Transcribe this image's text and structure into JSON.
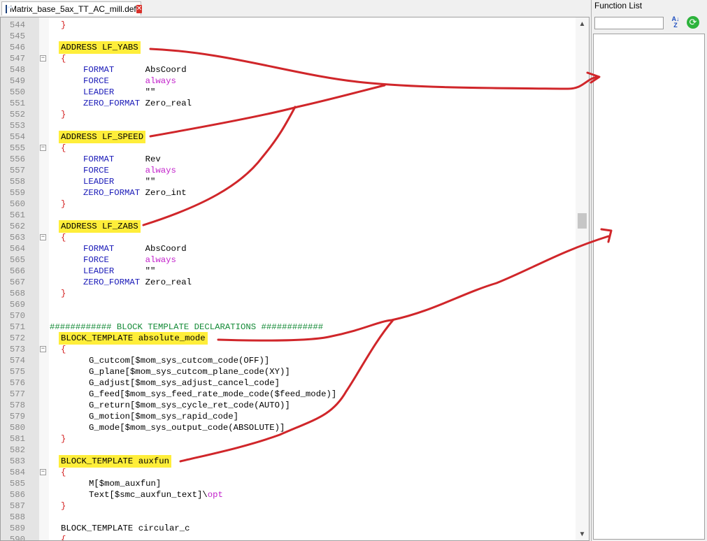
{
  "tab": {
    "title": "Matrix_base_5ax_TT_AC_mill.def",
    "close_icon": "close-icon",
    "save_icon": "save-icon"
  },
  "function_list": {
    "title": "Function List",
    "search_value": "",
    "sort_icon": "sort-az-icon",
    "reload_icon": "reload-icon"
  },
  "scrollbar": {
    "up_icon": "chevron-up-icon",
    "down_icon": "chevron-down-icon"
  },
  "lines": [
    {
      "n": "544",
      "fold": "",
      "indent": 1,
      "segs": [
        {
          "t": "}",
          "c": "br"
        }
      ]
    },
    {
      "n": "545",
      "fold": "",
      "indent": 0,
      "segs": []
    },
    {
      "n": "546",
      "fold": "",
      "indent": 1,
      "segs": [
        {
          "t": "ADDRESS LF_YABS",
          "c": "tl",
          "hl": true
        }
      ]
    },
    {
      "n": "547",
      "fold": "minus",
      "indent": 1,
      "segs": [
        {
          "t": "{",
          "c": "br"
        }
      ]
    },
    {
      "n": "548",
      "fold": "",
      "indent": 3,
      "segs": [
        {
          "t": "FORMAT      ",
          "c": "kw"
        },
        {
          "t": "AbsCoord",
          "c": "val"
        }
      ]
    },
    {
      "n": "549",
      "fold": "",
      "indent": 3,
      "segs": [
        {
          "t": "FORCE       ",
          "c": "kw"
        },
        {
          "t": "always",
          "c": "ml"
        }
      ]
    },
    {
      "n": "550",
      "fold": "",
      "indent": 3,
      "segs": [
        {
          "t": "LEADER      ",
          "c": "kw"
        },
        {
          "t": "\"\"",
          "c": "val"
        }
      ]
    },
    {
      "n": "551",
      "fold": "",
      "indent": 3,
      "segs": [
        {
          "t": "ZERO_FORMAT ",
          "c": "kw"
        },
        {
          "t": "Zero_real",
          "c": "val"
        }
      ]
    },
    {
      "n": "552",
      "fold": "",
      "indent": 1,
      "segs": [
        {
          "t": "}",
          "c": "br"
        }
      ]
    },
    {
      "n": "553",
      "fold": "",
      "indent": 0,
      "segs": []
    },
    {
      "n": "554",
      "fold": "",
      "indent": 1,
      "segs": [
        {
          "t": "ADDRESS LF_SPEED",
          "c": "tl",
          "hl": true
        }
      ]
    },
    {
      "n": "555",
      "fold": "minus",
      "indent": 1,
      "segs": [
        {
          "t": "{",
          "c": "br"
        }
      ]
    },
    {
      "n": "556",
      "fold": "",
      "indent": 3,
      "segs": [
        {
          "t": "FORMAT      ",
          "c": "kw"
        },
        {
          "t": "Rev",
          "c": "val"
        }
      ]
    },
    {
      "n": "557",
      "fold": "",
      "indent": 3,
      "segs": [
        {
          "t": "FORCE       ",
          "c": "kw"
        },
        {
          "t": "always",
          "c": "ml"
        }
      ]
    },
    {
      "n": "558",
      "fold": "",
      "indent": 3,
      "segs": [
        {
          "t": "LEADER      ",
          "c": "kw"
        },
        {
          "t": "\"\"",
          "c": "val"
        }
      ]
    },
    {
      "n": "559",
      "fold": "",
      "indent": 3,
      "segs": [
        {
          "t": "ZERO_FORMAT ",
          "c": "kw"
        },
        {
          "t": "Zero_int",
          "c": "val"
        }
      ]
    },
    {
      "n": "560",
      "fold": "",
      "indent": 1,
      "segs": [
        {
          "t": "}",
          "c": "br"
        }
      ]
    },
    {
      "n": "561",
      "fold": "",
      "indent": 0,
      "segs": []
    },
    {
      "n": "562",
      "fold": "",
      "indent": 1,
      "segs": [
        {
          "t": "ADDRESS LF_ZABS",
          "c": "tl",
          "hl": true
        }
      ]
    },
    {
      "n": "563",
      "fold": "minus",
      "indent": 1,
      "segs": [
        {
          "t": "{",
          "c": "br"
        }
      ]
    },
    {
      "n": "564",
      "fold": "",
      "indent": 3,
      "segs": [
        {
          "t": "FORMAT      ",
          "c": "kw"
        },
        {
          "t": "AbsCoord",
          "c": "val"
        }
      ]
    },
    {
      "n": "565",
      "fold": "",
      "indent": 3,
      "segs": [
        {
          "t": "FORCE       ",
          "c": "kw"
        },
        {
          "t": "always",
          "c": "ml"
        }
      ]
    },
    {
      "n": "566",
      "fold": "",
      "indent": 3,
      "segs": [
        {
          "t": "LEADER      ",
          "c": "kw"
        },
        {
          "t": "\"\"",
          "c": "val"
        }
      ]
    },
    {
      "n": "567",
      "fold": "",
      "indent": 3,
      "segs": [
        {
          "t": "ZERO_FORMAT ",
          "c": "kw"
        },
        {
          "t": "Zero_real",
          "c": "val"
        }
      ]
    },
    {
      "n": "568",
      "fold": "",
      "indent": 1,
      "segs": [
        {
          "t": "}",
          "c": "br"
        }
      ]
    },
    {
      "n": "569",
      "fold": "",
      "indent": 0,
      "segs": []
    },
    {
      "n": "570",
      "fold": "",
      "indent": 0,
      "segs": []
    },
    {
      "n": "571",
      "fold": "",
      "indent": 0,
      "segs": [
        {
          "t": "############ BLOCK TEMPLATE DECLARATIONS ############",
          "c": "cm"
        }
      ]
    },
    {
      "n": "572",
      "fold": "",
      "indent": 1,
      "segs": [
        {
          "t": "BLOCK_TEMPLATE absolute_mode",
          "c": "tl",
          "hl": true
        }
      ]
    },
    {
      "n": "573",
      "fold": "minus",
      "indent": 1,
      "segs": [
        {
          "t": "{",
          "c": "br"
        }
      ]
    },
    {
      "n": "574",
      "fold": "",
      "indent": 3.5,
      "segs": [
        {
          "t": "G_cutcom[$mom_sys_cutcom_code(OFF)]",
          "c": "val"
        }
      ]
    },
    {
      "n": "575",
      "fold": "",
      "indent": 3.5,
      "segs": [
        {
          "t": "G_plane[$mom_sys_cutcom_plane_code(XY)]",
          "c": "val"
        }
      ]
    },
    {
      "n": "576",
      "fold": "",
      "indent": 3.5,
      "segs": [
        {
          "t": "G_adjust[$mom_sys_adjust_cancel_code]",
          "c": "val"
        }
      ]
    },
    {
      "n": "577",
      "fold": "",
      "indent": 3.5,
      "segs": [
        {
          "t": "G_feed[$mom_sys_feed_rate_mode_code($feed_mode)]",
          "c": "val"
        }
      ]
    },
    {
      "n": "578",
      "fold": "",
      "indent": 3.5,
      "segs": [
        {
          "t": "G_return[$mom_sys_cycle_ret_code(AUTO)]",
          "c": "val"
        }
      ]
    },
    {
      "n": "579",
      "fold": "",
      "indent": 3.5,
      "segs": [
        {
          "t": "G_motion[$mom_sys_rapid_code]",
          "c": "val"
        }
      ]
    },
    {
      "n": "580",
      "fold": "",
      "indent": 3.5,
      "segs": [
        {
          "t": "G_mode[$mom_sys_output_code(ABSOLUTE)]",
          "c": "val"
        }
      ]
    },
    {
      "n": "581",
      "fold": "",
      "indent": 1,
      "segs": [
        {
          "t": "}",
          "c": "br"
        }
      ]
    },
    {
      "n": "582",
      "fold": "",
      "indent": 0,
      "segs": []
    },
    {
      "n": "583",
      "fold": "",
      "indent": 1,
      "segs": [
        {
          "t": "BLOCK_TEMPLATE auxfun",
          "c": "tl",
          "hl": true
        }
      ]
    },
    {
      "n": "584",
      "fold": "minus",
      "indent": 1,
      "segs": [
        {
          "t": "{",
          "c": "br"
        }
      ]
    },
    {
      "n": "585",
      "fold": "",
      "indent": 3.5,
      "segs": [
        {
          "t": "M[$mom_auxfun]",
          "c": "val"
        }
      ]
    },
    {
      "n": "586",
      "fold": "",
      "indent": 3.5,
      "segs": [
        {
          "t": "Text[$smc_auxfun_text]\\",
          "c": "val"
        },
        {
          "t": "opt",
          "c": "ml"
        }
      ]
    },
    {
      "n": "587",
      "fold": "",
      "indent": 1,
      "segs": [
        {
          "t": "}",
          "c": "br"
        }
      ]
    },
    {
      "n": "588",
      "fold": "",
      "indent": 0,
      "segs": []
    },
    {
      "n": "589",
      "fold": "",
      "indent": 1,
      "segs": [
        {
          "t": "BLOCK_TEMPLATE circular_c",
          "c": "tl"
        }
      ]
    },
    {
      "n": "590",
      "fold": "",
      "indent": 1,
      "segs": [
        {
          "t": "{",
          "c": "br"
        }
      ]
    }
  ],
  "colors": {
    "highlight": "#ffee3a",
    "keyword": "#1a1ab8",
    "string_literal": "#c21fcb",
    "brace": "#d42020",
    "comment": "#138a36",
    "annotation": "#d0262a"
  }
}
